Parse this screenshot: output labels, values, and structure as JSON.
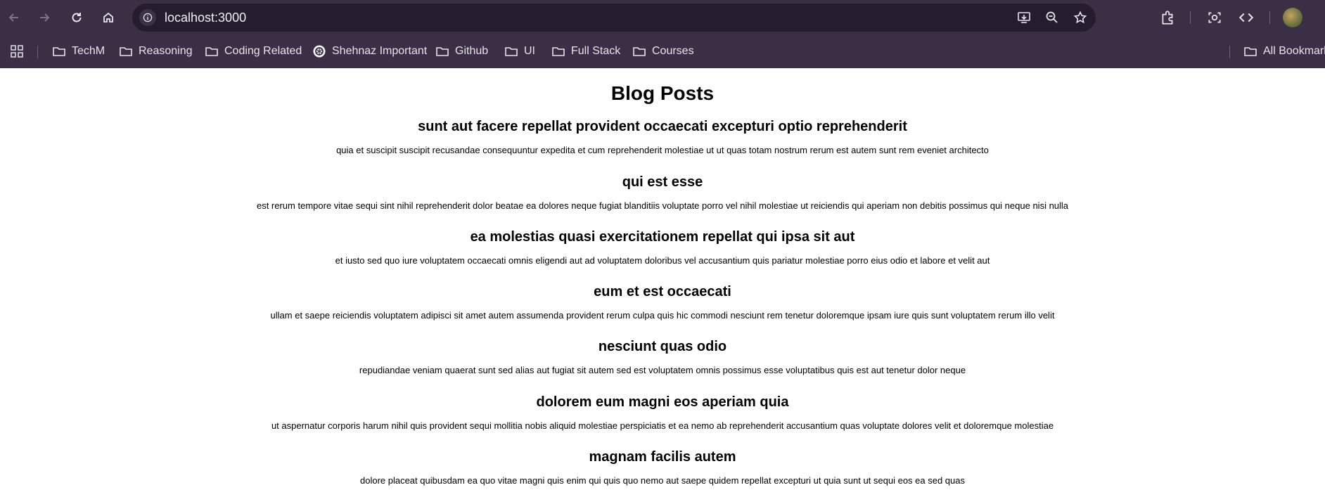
{
  "browser": {
    "url": "localhost:3000",
    "bookmarks": [
      {
        "label": "TechM",
        "icon": "folder-icon"
      },
      {
        "label": "Reasoning",
        "icon": "folder-icon"
      },
      {
        "label": "Coding Related",
        "icon": "folder-icon"
      },
      {
        "label": "Shehnaz Important",
        "icon": "openai-icon"
      },
      {
        "label": "Github",
        "icon": "folder-icon"
      },
      {
        "label": "UI",
        "icon": "folder-icon"
      },
      {
        "label": "Full Stack",
        "icon": "folder-icon"
      },
      {
        "label": "Courses",
        "icon": "folder-icon"
      }
    ],
    "all_bookmarks": "All Bookmarks"
  },
  "page": {
    "heading": "Blog Posts",
    "posts": [
      {
        "title": "sunt aut facere repellat provident occaecati excepturi optio reprehenderit",
        "body": "quia et suscipit suscipit recusandae consequuntur expedita et cum reprehenderit molestiae ut ut quas totam nostrum rerum est autem sunt rem eveniet architecto"
      },
      {
        "title": "qui est esse",
        "body": "est rerum tempore vitae sequi sint nihil reprehenderit dolor beatae ea dolores neque fugiat blanditiis voluptate porro vel nihil molestiae ut reiciendis qui aperiam non debitis possimus qui neque nisi nulla"
      },
      {
        "title": "ea molestias quasi exercitationem repellat qui ipsa sit aut",
        "body": "et iusto sed quo iure voluptatem occaecati omnis eligendi aut ad voluptatem doloribus vel accusantium quis pariatur molestiae porro eius odio et labore et velit aut"
      },
      {
        "title": "eum et est occaecati",
        "body": "ullam et saepe reiciendis voluptatem adipisci sit amet autem assumenda provident rerum culpa quis hic commodi nesciunt rem tenetur doloremque ipsam iure quis sunt voluptatem rerum illo velit"
      },
      {
        "title": "nesciunt quas odio",
        "body": "repudiandae veniam quaerat sunt sed alias aut fugiat sit autem sed est voluptatem omnis possimus esse voluptatibus quis est aut tenetur dolor neque"
      },
      {
        "title": "dolorem eum magni eos aperiam quia",
        "body": "ut aspernatur corporis harum nihil quis provident sequi mollitia nobis aliquid molestiae perspiciatis et ea nemo ab reprehenderit accusantium quas voluptate dolores velit et doloremque molestiae"
      },
      {
        "title": "magnam facilis autem",
        "body": "dolore placeat quibusdam ea quo vitae magni quis enim qui quis quo nemo aut saepe quidem repellat excepturi ut quia sunt ut sequi eos ea sed quas"
      }
    ]
  }
}
